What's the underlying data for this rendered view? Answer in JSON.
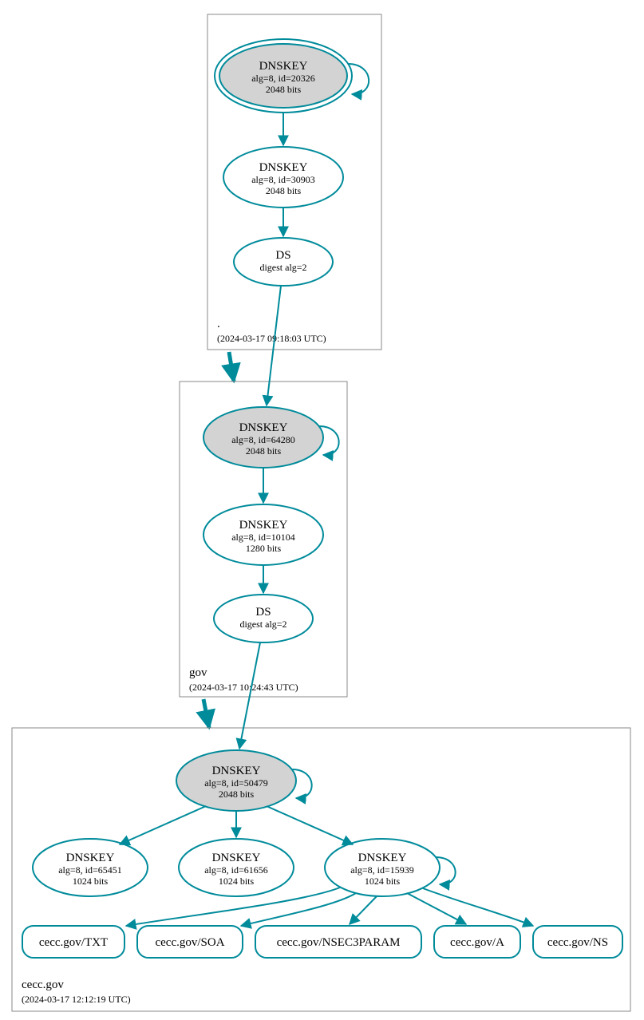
{
  "zones": {
    "root": {
      "label": ".",
      "timestamp": "(2024-03-17 09:18:03 UTC)"
    },
    "gov": {
      "label": "gov",
      "timestamp": "(2024-03-17 10:24:43 UTC)"
    },
    "cecc": {
      "label": "cecc.gov",
      "timestamp": "(2024-03-17 12:12:19 UTC)"
    }
  },
  "nodes": {
    "root_ksk": {
      "title": "DNSKEY",
      "line2": "alg=8, id=20326",
      "line3": "2048 bits"
    },
    "root_zsk": {
      "title": "DNSKEY",
      "line2": "alg=8, id=30903",
      "line3": "2048 bits"
    },
    "root_ds": {
      "title": "DS",
      "line2": "digest alg=2"
    },
    "gov_ksk": {
      "title": "DNSKEY",
      "line2": "alg=8, id=64280",
      "line3": "2048 bits"
    },
    "gov_zsk": {
      "title": "DNSKEY",
      "line2": "alg=8, id=10104",
      "line3": "1280 bits"
    },
    "gov_ds": {
      "title": "DS",
      "line2": "digest alg=2"
    },
    "cecc_ksk": {
      "title": "DNSKEY",
      "line2": "alg=8, id=50479",
      "line3": "2048 bits"
    },
    "cecc_k1": {
      "title": "DNSKEY",
      "line2": "alg=8, id=65451",
      "line3": "1024 bits"
    },
    "cecc_k2": {
      "title": "DNSKEY",
      "line2": "alg=8, id=61656",
      "line3": "1024 bits"
    },
    "cecc_k3": {
      "title": "DNSKEY",
      "line2": "alg=8, id=15939",
      "line3": "1024 bits"
    }
  },
  "rr": {
    "txt": "cecc.gov/TXT",
    "soa": "cecc.gov/SOA",
    "nsec3": "cecc.gov/NSEC3PARAM",
    "a": "cecc.gov/A",
    "ns": "cecc.gov/NS"
  }
}
